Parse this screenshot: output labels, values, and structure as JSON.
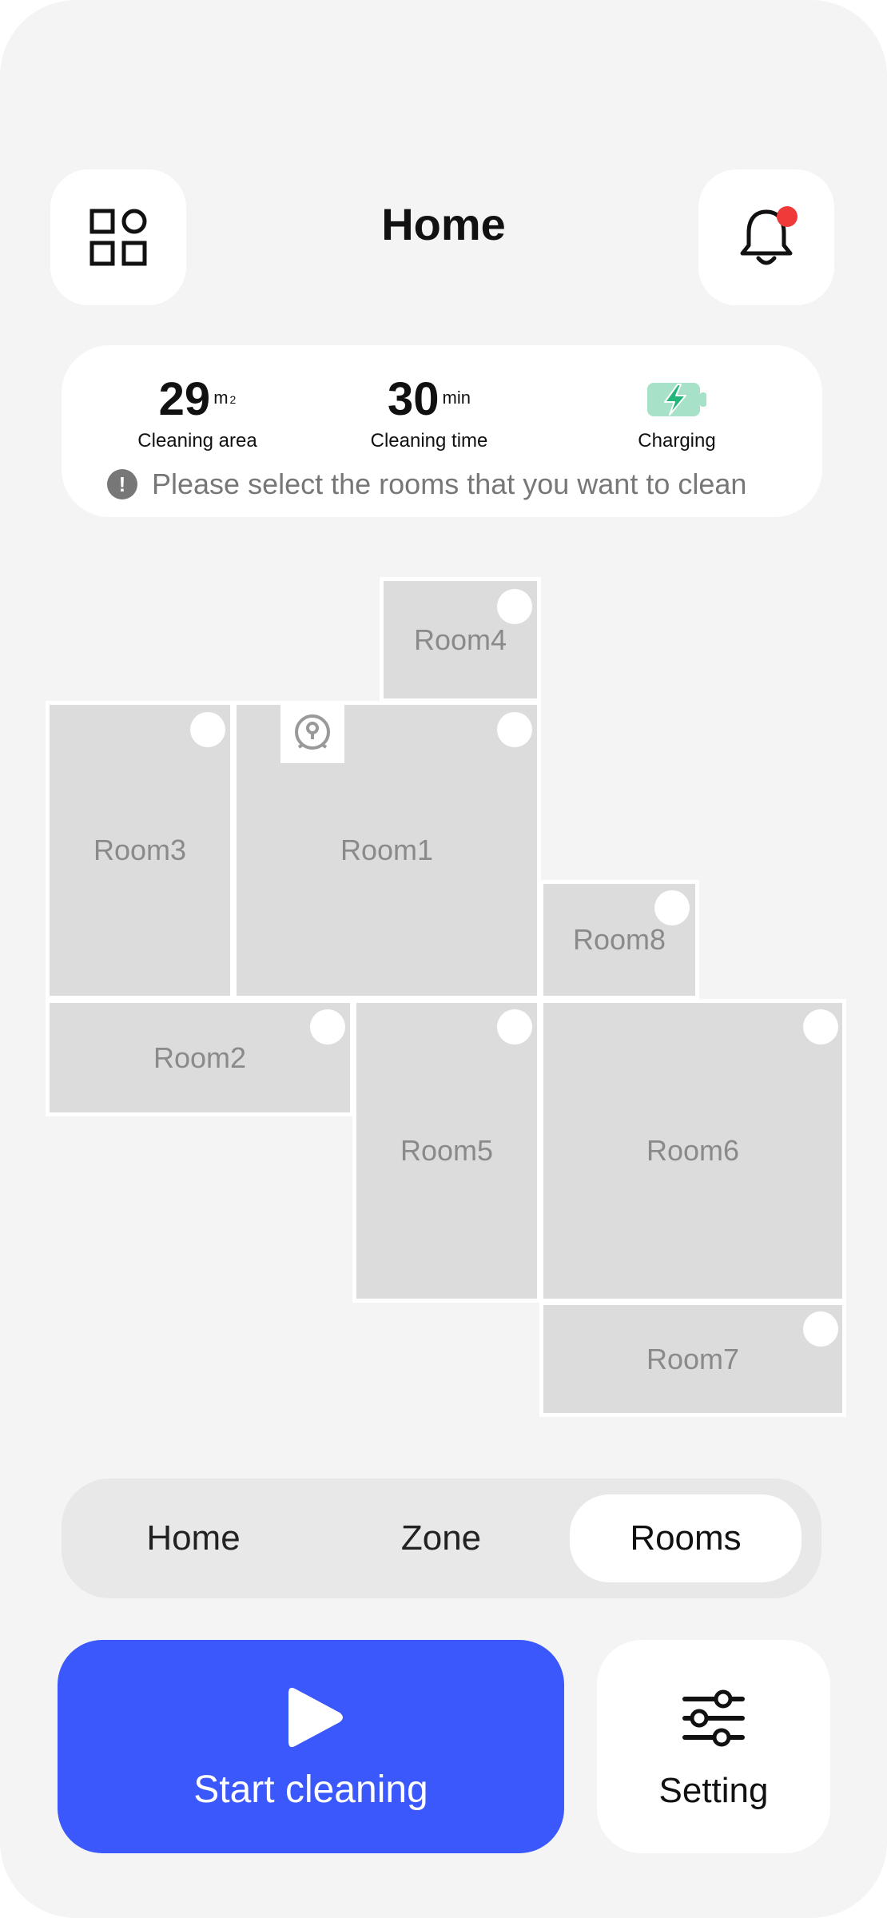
{
  "header": {
    "title": "Home"
  },
  "stats": {
    "area_value": "29",
    "area_unit": "m",
    "area_unit_sup": "2",
    "area_label": "Cleaning area",
    "time_value": "30",
    "time_unit": "min",
    "time_label": "Cleaning time",
    "charge_label": "Charging"
  },
  "notice": "Please select the rooms that you want to clean",
  "rooms": {
    "room1": "Room1",
    "room2": "Room2",
    "room3": "Room3",
    "room4": "Room4",
    "room5": "Room5",
    "room6": "Room6",
    "room7": "Room7",
    "room8": "Room8"
  },
  "tabs": {
    "home": "Home",
    "zone": "Zone",
    "rooms": "Rooms",
    "selected": "Rooms"
  },
  "actions": {
    "start": "Start cleaning",
    "setting": "Setting"
  },
  "colors": {
    "primary": "#3a58fc",
    "notification_dot": "#f03a3a",
    "battery": "#23b57a",
    "room_fill": "#dcdcdc",
    "background": "#f4f4f4"
  },
  "icons": {
    "menu": "grid-menu-icon",
    "bell": "bell-icon",
    "battery": "battery-charging-icon",
    "notice": "exclamation-icon",
    "robot": "robot-vacuum-icon",
    "start": "play-icon",
    "setting": "sliders-icon"
  }
}
